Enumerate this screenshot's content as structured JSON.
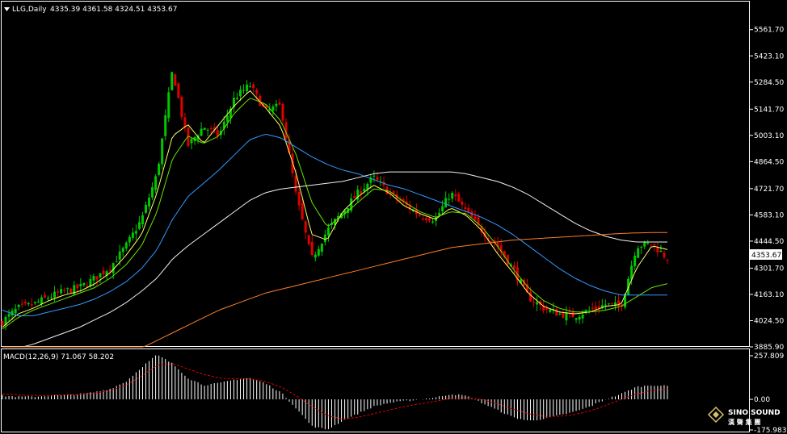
{
  "header": {
    "symbol_label": "LLG,Daily",
    "ohlc_label": "4335.39 4361.58 4324.51 4353.67"
  },
  "macd": {
    "label": "MACD(12,26,9) 71.067 58.202"
  },
  "watermark": {
    "line1": "SINO SOUND",
    "line2": "漢 聲 集 團"
  },
  "colors": {
    "background": "#000000",
    "frame": "#ffffff",
    "bull": "#00c800",
    "bear": "#e00000",
    "ma_yellow": "#ffff66",
    "ma_green": "#66e600",
    "ma_blue": "#3399ff",
    "ma_white": "#f0f0f0",
    "ma_orange": "#ff7f27",
    "macd_hist": "#ffffff",
    "macd_signal": "#e00000",
    "price_tag": "#ffffff"
  },
  "chart_data": {
    "type": "candlestick",
    "last_price_label": "4353.67",
    "ylim": [
      3885.9,
      5633.0
    ],
    "y_ticks": [
      "5561.70",
      "5423.10",
      "5284.50",
      "5141.70",
      "5003.10",
      "4864.50",
      "4721.70",
      "4583.10",
      "4444.50",
      "4301.70",
      "4163.10",
      "4024.50",
      "3885.90"
    ],
    "y_tick_values": [
      5561.7,
      5423.1,
      5284.5,
      5141.7,
      5003.1,
      4864.5,
      4721.7,
      4583.1,
      4444.5,
      4301.7,
      4163.1,
      4024.5,
      3885.9
    ],
    "price_path": [
      4020,
      4090,
      4110,
      4150,
      4180,
      4200,
      4250,
      4310,
      4420,
      4560,
      4800,
      5350,
      4950,
      5050,
      5000,
      5200,
      5270,
      5130,
      5160,
      4680,
      4350,
      4500,
      4600,
      4700,
      4780,
      4700,
      4640,
      4580,
      4560,
      4700,
      4600,
      4500,
      4420,
      4300,
      4150,
      4090,
      4060,
      4050,
      4080,
      4110,
      4100,
      4420,
      4430,
      4353.67
    ],
    "ma_series": [
      {
        "color_key": "ma_yellow",
        "values": [
          3990,
          4060,
          4090,
          4130,
          4160,
          4180,
          4220,
          4280,
          4370,
          4480,
          4700,
          5000,
          5060,
          4960,
          5060,
          5160,
          5240,
          5150,
          5050,
          4800,
          4480,
          4450,
          4600,
          4680,
          4740,
          4700,
          4630,
          4590,
          4560,
          4620,
          4580,
          4500,
          4380,
          4280,
          4170,
          4100,
          4070,
          4060,
          4070,
          4100,
          4110,
          4300,
          4420,
          4400
        ]
      },
      {
        "color_key": "ma_green",
        "values": [
          3980,
          4040,
          4080,
          4110,
          4140,
          4170,
          4200,
          4250,
          4320,
          4420,
          4600,
          4880,
          5000,
          4960,
          5000,
          5120,
          5200,
          5170,
          5080,
          4900,
          4650,
          4520,
          4580,
          4650,
          4720,
          4710,
          4650,
          4600,
          4570,
          4600,
          4590,
          4520,
          4420,
          4300,
          4200,
          4130,
          4090,
          4070,
          4070,
          4080,
          4100,
          4150,
          4200,
          4220
        ]
      },
      {
        "color_key": "ma_blue",
        "values": [
          4080,
          4050,
          4050,
          4070,
          4090,
          4110,
          4140,
          4180,
          4230,
          4300,
          4400,
          4560,
          4680,
          4750,
          4820,
          4900,
          4980,
          5010,
          4990,
          4940,
          4890,
          4850,
          4820,
          4800,
          4770,
          4740,
          4720,
          4690,
          4660,
          4630,
          4600,
          4570,
          4530,
          4480,
          4420,
          4360,
          4300,
          4250,
          4210,
          4180,
          4160,
          4160,
          4160,
          4160
        ]
      },
      {
        "color_key": "ma_white",
        "values": [
          3870,
          3880,
          3900,
          3930,
          3960,
          3990,
          4030,
          4070,
          4120,
          4180,
          4250,
          4350,
          4420,
          4480,
          4540,
          4600,
          4660,
          4700,
          4720,
          4730,
          4740,
          4750,
          4760,
          4780,
          4800,
          4810,
          4810,
          4810,
          4810,
          4810,
          4800,
          4780,
          4760,
          4730,
          4690,
          4640,
          4590,
          4540,
          4500,
          4470,
          4450,
          4440,
          4440,
          4440
        ]
      },
      {
        "color_key": "ma_orange",
        "values": [
          3600,
          3620,
          3640,
          3670,
          3700,
          3730,
          3760,
          3800,
          3840,
          3880,
          3920,
          3960,
          4000,
          4040,
          4080,
          4110,
          4140,
          4170,
          4190,
          4210,
          4230,
          4250,
          4270,
          4290,
          4310,
          4330,
          4350,
          4370,
          4390,
          4410,
          4420,
          4430,
          4440,
          4450,
          4455,
          4460,
          4465,
          4470,
          4475,
          4480,
          4485,
          4488,
          4490,
          4490
        ]
      }
    ],
    "macd_hist_path": [
      20,
      15,
      15,
      20,
      25,
      30,
      40,
      60,
      100,
      180,
      250,
      200,
      120,
      80,
      90,
      110,
      120,
      90,
      40,
      -50,
      -150,
      -170,
      -120,
      -80,
      -40,
      -20,
      -10,
      0,
      10,
      30,
      20,
      -20,
      -60,
      -100,
      -120,
      -110,
      -90,
      -70,
      -40,
      0,
      30,
      70,
      80,
      75
    ],
    "macd_signal_path": [
      30,
      25,
      22,
      22,
      25,
      28,
      35,
      50,
      80,
      130,
      190,
      200,
      170,
      140,
      120,
      115,
      115,
      100,
      70,
      20,
      -40,
      -90,
      -110,
      -100,
      -80,
      -60,
      -40,
      -25,
      -10,
      5,
      10,
      0,
      -25,
      -55,
      -80,
      -95,
      -95,
      -85,
      -65,
      -35,
      0,
      30,
      50,
      58
    ],
    "macd_ylim": [
      -175.983,
      257.809
    ],
    "macd_ticks": [
      "257.809",
      "0.00",
      "-175.983"
    ],
    "macd_tick_values": [
      257.809,
      0,
      -175.983
    ]
  }
}
